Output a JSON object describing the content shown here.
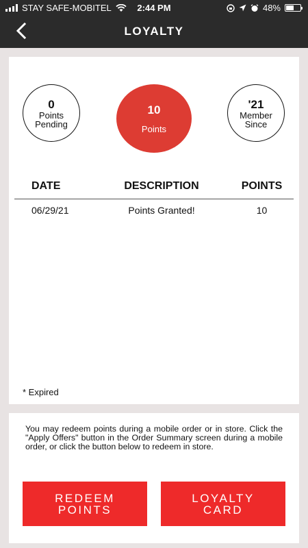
{
  "status": {
    "carrier": "STAY SAFE-MOBITEL",
    "time": "2:44 PM",
    "battery": "48%",
    "battery_level": 0.48
  },
  "nav": {
    "title": "LOYALTY",
    "back_icon": "chevron-left-icon"
  },
  "summary": {
    "pending": {
      "value": "0",
      "label_line1": "Points",
      "label_line2": "Pending"
    },
    "points": {
      "value": "10",
      "label": "Points"
    },
    "member": {
      "value": "'21",
      "label_line1": "Member",
      "label_line2": "Since"
    }
  },
  "table": {
    "headers": {
      "date": "DATE",
      "description": "DESCRIPTION",
      "points": "POINTS"
    },
    "rows": [
      {
        "date": "06/29/21",
        "description": "Points Granted!",
        "points": "10"
      }
    ]
  },
  "expired_note": "* Expired",
  "info_text": "You may redeem points during a mobile order or in store. Click the \"Apply Offers\" button in the Order Summary screen during a mobile order, or click the button below to redeem in store.",
  "buttons": {
    "redeem": "REDEEM\nPOINTS",
    "loyalty_card": "LOYALTY\nCARD"
  },
  "colors": {
    "accent": "#dd3c33",
    "button": "#ee2a2a",
    "header": "#2b2b2b"
  }
}
